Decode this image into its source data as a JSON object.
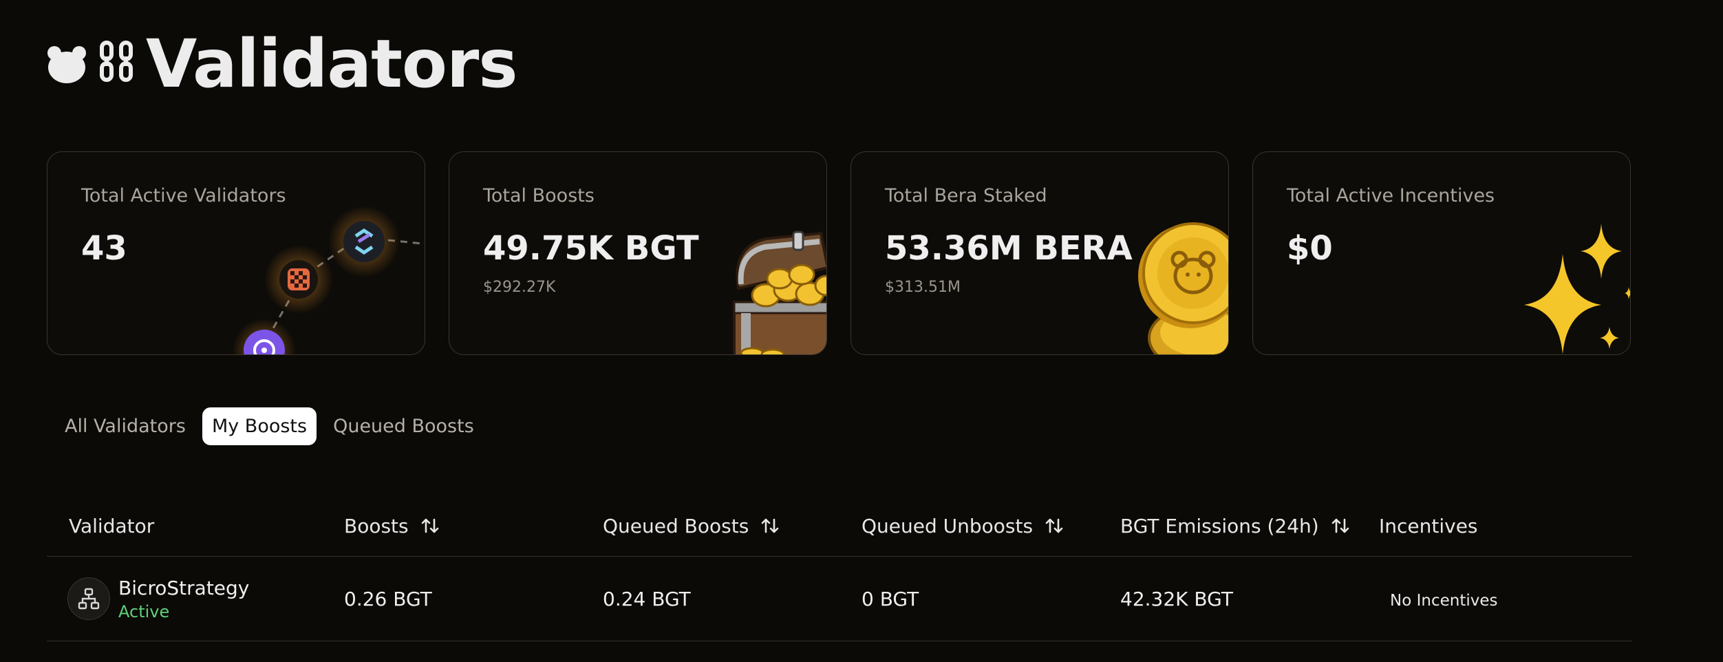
{
  "page": {
    "title": "Validators"
  },
  "stats": [
    {
      "label": "Total Active Validators",
      "value": "43",
      "sub": ""
    },
    {
      "label": "Total Boosts",
      "value": "49.75K BGT",
      "sub": "$292.27K"
    },
    {
      "label": "Total Bera Staked",
      "value": "53.36M BERA",
      "sub": "$313.51M"
    },
    {
      "label": "Total Active Incentives",
      "value": "$0",
      "sub": ""
    }
  ],
  "tabs": [
    {
      "label": "All Validators",
      "active": false
    },
    {
      "label": "My Boosts",
      "active": true
    },
    {
      "label": "Queued Boosts",
      "active": false
    }
  ],
  "table": {
    "columns": [
      "Validator",
      "Boosts",
      "Queued Boosts",
      "Queued Unboosts",
      "BGT Emissions (24h)",
      "Incentives"
    ],
    "rows": [
      {
        "validator": "BicroStrategy",
        "status": "Active",
        "boosts": "0.26 BGT",
        "queued_boosts": "0.24 BGT",
        "queued_unboosts": "0 BGT",
        "bgt_emissions": "42.32K BGT",
        "incentives": "No Incentives"
      }
    ]
  },
  "colors": {
    "background": "#0c0a07",
    "accent_gold": "#f2c230",
    "status_active": "#5fd07a"
  },
  "icons": [
    "bear-icon",
    "chain-link-icon",
    "sort-icon",
    "validator-avatar-icon",
    "treasure-chest-icon",
    "bera-coin-icon",
    "sparkles-icon"
  ]
}
